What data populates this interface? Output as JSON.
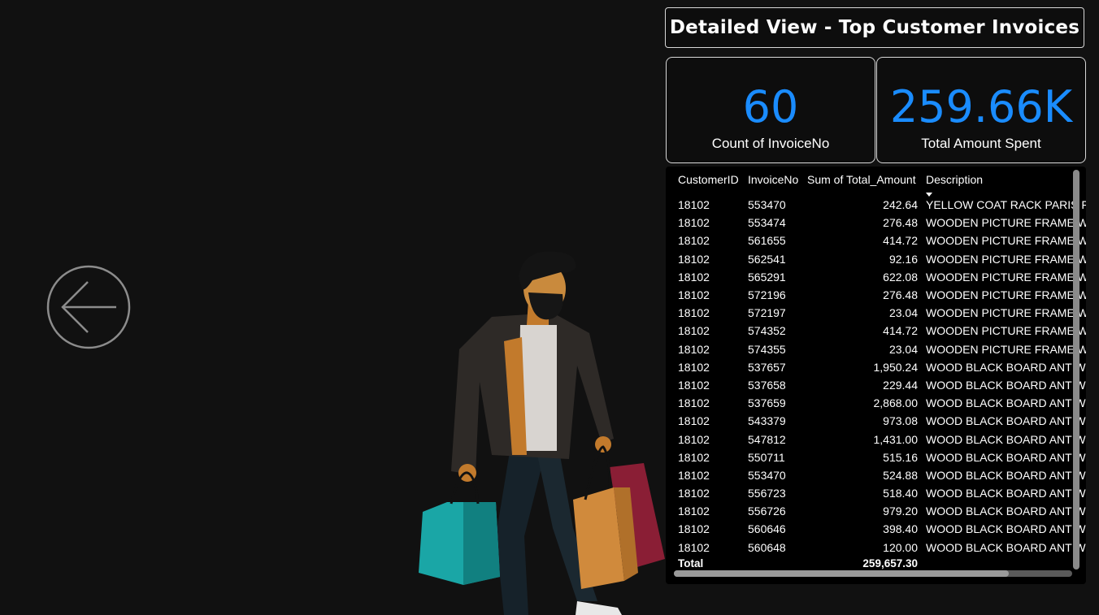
{
  "title": "Detailed View - Top Customer Invoices",
  "kpis": {
    "count": {
      "value": "60",
      "label": "Count of InvoiceNo"
    },
    "total": {
      "value": "259.66K",
      "label": "Total Amount Spent"
    }
  },
  "colors": {
    "accent": "#1a8cff",
    "background": "#111111"
  },
  "table": {
    "headers": [
      "CustomerID",
      "InvoiceNo",
      "Sum of Total_Amount",
      "Description"
    ],
    "sorted_column": "Description",
    "rows": [
      [
        "18102",
        "553470",
        "242.64",
        "YELLOW COAT RACK PARIS FA"
      ],
      [
        "18102",
        "553474",
        "276.48",
        "WOODEN PICTURE FRAME W"
      ],
      [
        "18102",
        "561655",
        "414.72",
        "WOODEN PICTURE FRAME W"
      ],
      [
        "18102",
        "562541",
        "92.16",
        "WOODEN PICTURE FRAME W"
      ],
      [
        "18102",
        "565291",
        "622.08",
        "WOODEN PICTURE FRAME W"
      ],
      [
        "18102",
        "572196",
        "276.48",
        "WOODEN PICTURE FRAME W"
      ],
      [
        "18102",
        "572197",
        "23.04",
        "WOODEN PICTURE FRAME W"
      ],
      [
        "18102",
        "574352",
        "414.72",
        "WOODEN PICTURE FRAME W"
      ],
      [
        "18102",
        "574355",
        "23.04",
        "WOODEN PICTURE FRAME W"
      ],
      [
        "18102",
        "537657",
        "1,950.24",
        "WOOD BLACK BOARD ANT W"
      ],
      [
        "18102",
        "537658",
        "229.44",
        "WOOD BLACK BOARD ANT W"
      ],
      [
        "18102",
        "537659",
        "2,868.00",
        "WOOD BLACK BOARD ANT W"
      ],
      [
        "18102",
        "543379",
        "973.08",
        "WOOD BLACK BOARD ANT W"
      ],
      [
        "18102",
        "547812",
        "1,431.00",
        "WOOD BLACK BOARD ANT W"
      ],
      [
        "18102",
        "550711",
        "515.16",
        "WOOD BLACK BOARD ANT W"
      ],
      [
        "18102",
        "553470",
        "524.88",
        "WOOD BLACK BOARD ANT W"
      ],
      [
        "18102",
        "556723",
        "518.40",
        "WOOD BLACK BOARD ANT W"
      ],
      [
        "18102",
        "556726",
        "979.20",
        "WOOD BLACK BOARD ANT W"
      ],
      [
        "18102",
        "560646",
        "398.40",
        "WOOD BLACK BOARD ANT W"
      ],
      [
        "18102",
        "560648",
        "120.00",
        "WOOD BLACK BOARD ANT W"
      ]
    ],
    "total": {
      "label": "Total",
      "value": "259,657.30"
    }
  },
  "icons": {
    "back": "arrow-left-circle-icon",
    "illustration": "shopper-with-bags-illustration"
  }
}
